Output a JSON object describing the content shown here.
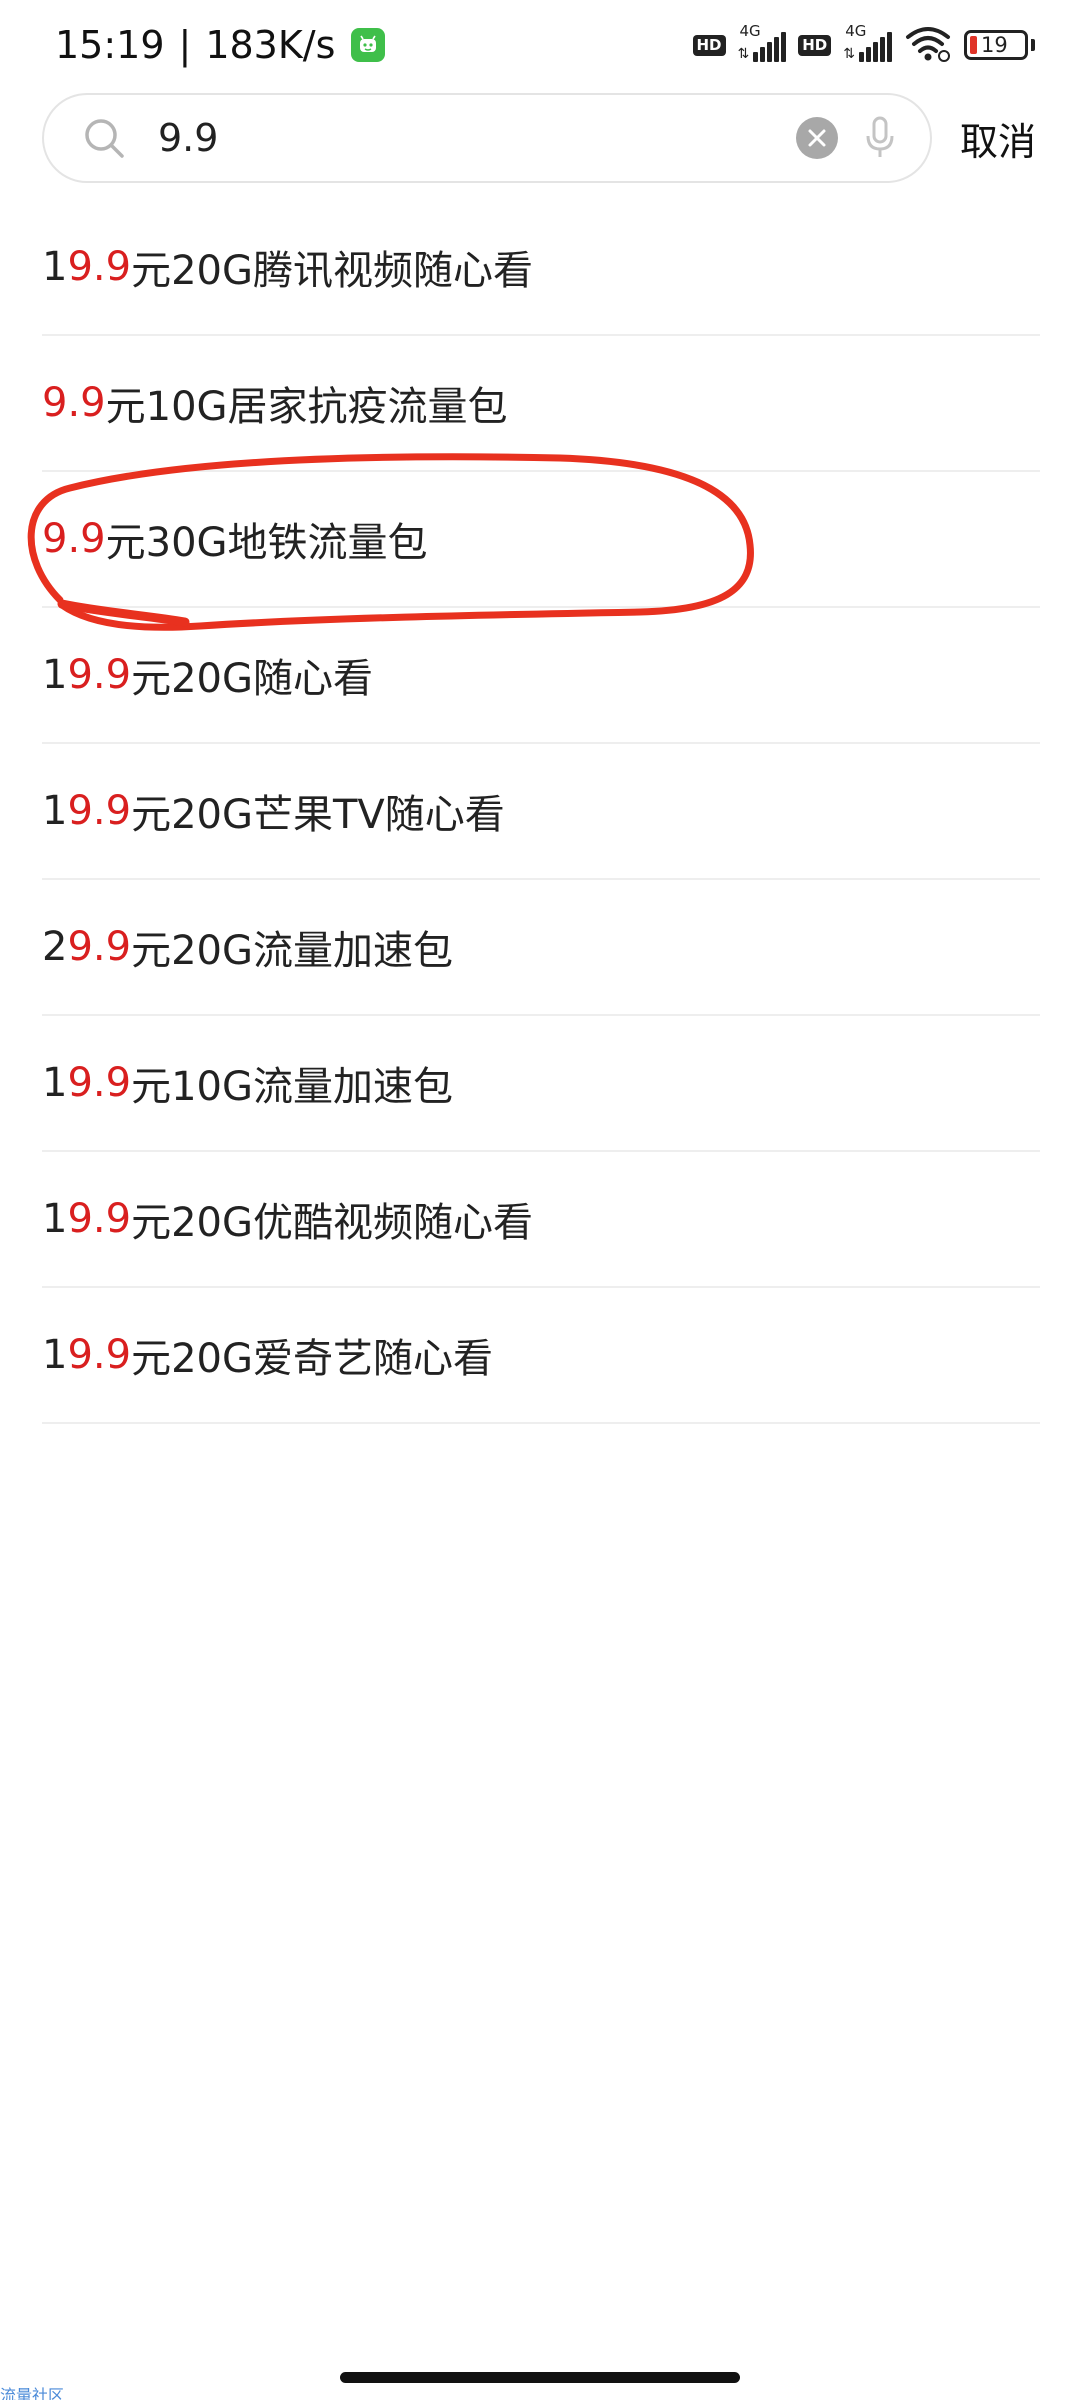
{
  "status_bar": {
    "time": "15:19",
    "separator": "|",
    "speed": "183K/s",
    "network1": "4G",
    "network2": "4G",
    "hd_label": "HD",
    "battery": "19",
    "battery_color": "#e03428"
  },
  "search": {
    "value": "9.9",
    "cancel_label": "取消"
  },
  "results": [
    {
      "prefix": "1",
      "highlight": "9.9",
      "suffix": "元20G腾讯视频随心看"
    },
    {
      "prefix": "",
      "highlight": "9.9",
      "suffix": "元10G居家抗疫流量包"
    },
    {
      "prefix": "",
      "highlight": "9.9",
      "suffix": "元30G地铁流量包"
    },
    {
      "prefix": "1",
      "highlight": "9.9",
      "suffix": "元20G随心看"
    },
    {
      "prefix": "1",
      "highlight": "9.9",
      "suffix": "元20G芒果TV随心看"
    },
    {
      "prefix": "2",
      "highlight": "9.9",
      "suffix": "元20G流量加速包"
    },
    {
      "prefix": "1",
      "highlight": "9.9",
      "suffix": "元10G流量加速包"
    },
    {
      "prefix": "1",
      "highlight": "9.9",
      "suffix": "元20G优酷视频随心看"
    },
    {
      "prefix": "1",
      "highlight": "9.9",
      "suffix": "元20G爱奇艺随心看"
    }
  ],
  "watermark": "流量社区",
  "colors": {
    "highlight": "#d91f1f",
    "annotation": "#e8311f"
  }
}
